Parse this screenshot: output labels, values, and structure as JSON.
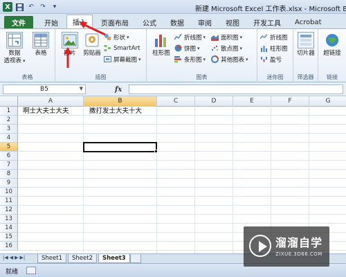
{
  "titlebar": {
    "title": "新建 Microsoft Excel 工作表.xlsx - Microsoft Excel",
    "qat_undo": "↶",
    "qat_redo": "↷"
  },
  "tabs": [
    {
      "label": "文件"
    },
    {
      "label": "开始"
    },
    {
      "label": "插入"
    },
    {
      "label": "页面布局"
    },
    {
      "label": "公式"
    },
    {
      "label": "数据"
    },
    {
      "label": "审阅"
    },
    {
      "label": "视图"
    },
    {
      "label": "开发工具"
    },
    {
      "label": "Acrobat"
    }
  ],
  "ribbon": {
    "groups": {
      "tables": "表格",
      "illustrations": "插图",
      "charts": "图表",
      "sparklines": "迷你图",
      "filter": "筛选器",
      "links": "链接"
    },
    "pivot_label": "数据\n透视表",
    "pivot_line1": "数据",
    "pivot_line2": "透视表",
    "table_label": "表格",
    "picture_label": "图片",
    "clipart_label": "剪贴画",
    "shapes_label": "形状",
    "smartart_label": "SmartArt",
    "screenshot_label": "屏幕截图",
    "column_chart_label": "柱形图",
    "line_chart_label": "折线图",
    "pie_chart_label": "饼图",
    "bar_chart_label": "条形图",
    "area_chart_label": "面积图",
    "scatter_chart_label": "散点图",
    "other_chart_label": "其他图表",
    "spark_line_label": "折线图",
    "spark_column_label": "柱形图",
    "spark_winloss_label": "盈亏",
    "slicer_label": "切片器",
    "hyperlink_label": "超链接"
  },
  "colors": {
    "file_tab": "#2a7a3e",
    "selected_header": "#f2c46b",
    "annotation": "#e02020"
  },
  "formula_bar": {
    "name_box": "B5",
    "fx": "fx",
    "content": ""
  },
  "sheet": {
    "columns": [
      "A",
      "B",
      "C",
      "D",
      "E",
      "F",
      "G"
    ],
    "rows": [
      "1",
      "2",
      "3",
      "4",
      "5",
      "6",
      "7",
      "8",
      "9",
      "10",
      "11",
      "12",
      "13",
      "14",
      "15",
      "16"
    ],
    "cells": {
      "A1": "啊士大夫士大夫",
      "B1": "撒打发士大夫十大"
    },
    "active_cell": "B5"
  },
  "sheet_tabs": [
    "Sheet1",
    "Sheet2",
    "Sheet3"
  ],
  "status": {
    "ready": "就绪"
  },
  "watermark": {
    "main": "溜溜自学",
    "sub": "ZIXUE.3D66.COM"
  }
}
